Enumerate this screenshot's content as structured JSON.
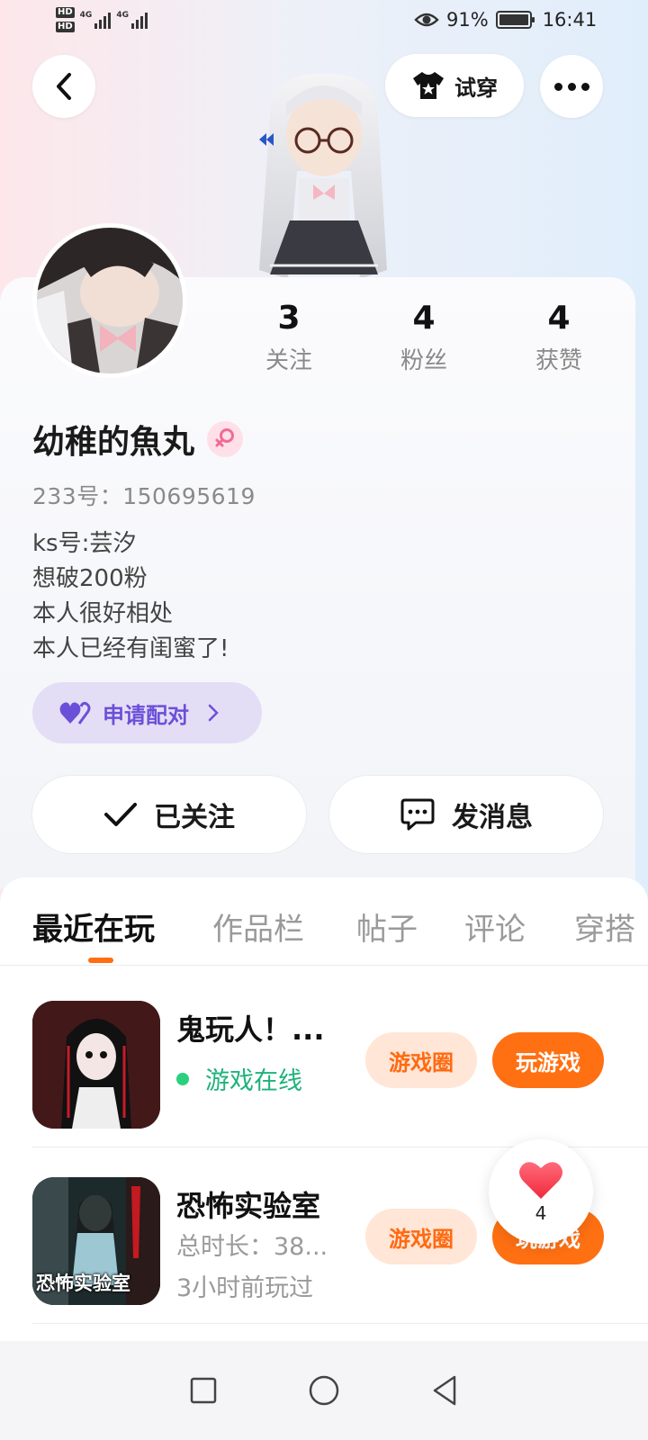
{
  "status_bar": {
    "battery_percent": "91%",
    "time": "16:41",
    "network_1": "HD",
    "network_2": "HD",
    "signal_label_1": "4G",
    "signal_label_2": "4G"
  },
  "header": {
    "try_on_label": "试穿"
  },
  "profile": {
    "stats": [
      {
        "value": "3",
        "label": "关注"
      },
      {
        "value": "4",
        "label": "粉丝"
      },
      {
        "value": "4",
        "label": "获赞"
      }
    ],
    "nickname": "幼稚的魚丸",
    "gender_icon": "female-icon",
    "uid": "233号：150695619",
    "bio": [
      "ks号:芸汐",
      "想破200粉",
      "本人很好相处",
      "本人已经有闺蜜了!"
    ],
    "pair_button": "申请配对",
    "follow_button": "已关注",
    "message_button": "发消息"
  },
  "tabs": [
    "最近在玩",
    "作品栏",
    "帖子",
    "评论",
    "穿搭"
  ],
  "active_tab": "最近在玩",
  "games": [
    {
      "title": "鬼玩人！...",
      "status": "游戏在线",
      "circle_label": "游戏圈",
      "play_label": "玩游戏"
    },
    {
      "title": "恐怖实验室",
      "duration": "总时长：38...",
      "last_played": "3小时前玩过",
      "circle_label": "游戏圈",
      "play_label": "玩游戏",
      "icon_text": "恐怖实验室"
    }
  ],
  "like_float": {
    "count": "4"
  },
  "colors": {
    "accent": "#ff7012",
    "pair_purple": "#6a50d8",
    "online_green": "#1fb27a"
  }
}
